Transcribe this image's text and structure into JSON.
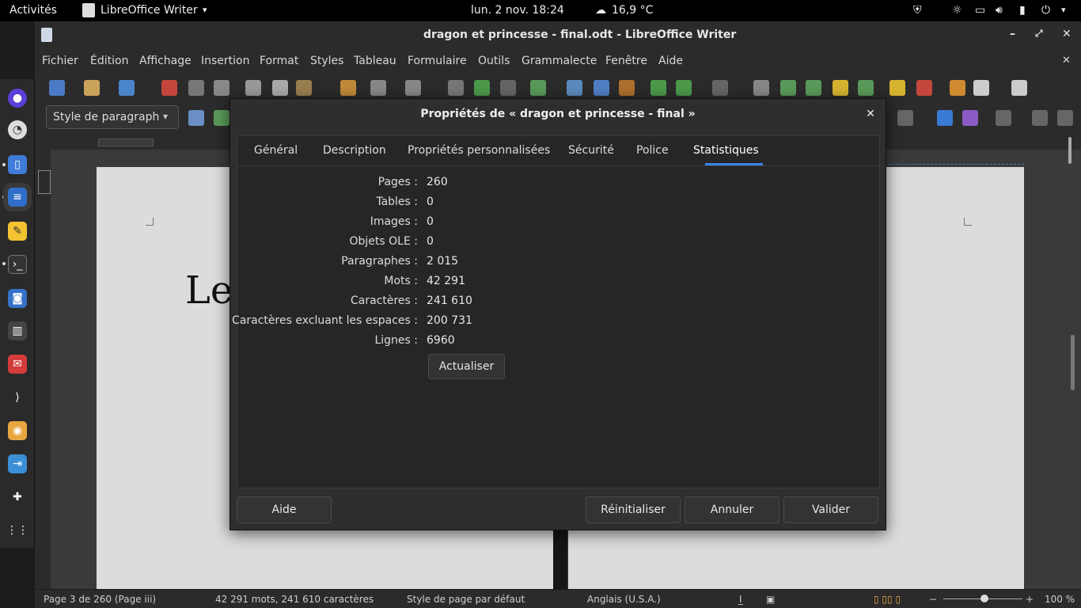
{
  "topbar": {
    "activities": "Activités",
    "app_name": "LibreOffice Writer",
    "clock": "lun. 2 nov.  18:24",
    "weather": "16,9 °C"
  },
  "window": {
    "title": "dragon et princesse - final.odt - LibreOffice Writer"
  },
  "menu": [
    "Fichier",
    "Édition",
    "Affichage",
    "Insertion",
    "Format",
    "Styles",
    "Tableau",
    "Formulaire",
    "Outils",
    "Grammalecte",
    "Fenêtre",
    "Aide"
  ],
  "toolbar": {
    "paragraph_style": "Style de paragraph"
  },
  "document": {
    "visible_text": "Le"
  },
  "dialog": {
    "title": "Propriétés de « dragon et princesse - final »",
    "tabs": [
      "Général",
      "Description",
      "Propriétés personnalisées",
      "Sécurité",
      "Police",
      "Statistiques"
    ],
    "active_tab": "Statistiques",
    "stats": [
      {
        "label": "Pages :",
        "value": "260"
      },
      {
        "label": "Tables :",
        "value": "0"
      },
      {
        "label": "Images :",
        "value": "0"
      },
      {
        "label": "Objets OLE :",
        "value": "0"
      },
      {
        "label": "Paragraphes :",
        "value": "2 015"
      },
      {
        "label": "Mots :",
        "value": "42 291"
      },
      {
        "label": "Caractères :",
        "value": "241 610"
      },
      {
        "label": "Caractères excluant les espaces :",
        "value": "200 731"
      },
      {
        "label": "Lignes :",
        "value": "6960"
      }
    ],
    "update_button": "Actualiser",
    "help_button": "Aide",
    "reset_button": "Réinitialiser",
    "cancel_button": "Annuler",
    "ok_button": "Valider"
  },
  "statusbar": {
    "page": "Page 3 de 260 (Page iii)",
    "words": "42 291 mots, 241 610 caractères",
    "page_style": "Style de page par défaut",
    "language": "Anglais (U.S.A.)",
    "zoom": "100 %"
  },
  "colors": {
    "accent": "#3584e4",
    "dialog_bg": "#2e2e2e",
    "topbar_bg": "#000000"
  }
}
